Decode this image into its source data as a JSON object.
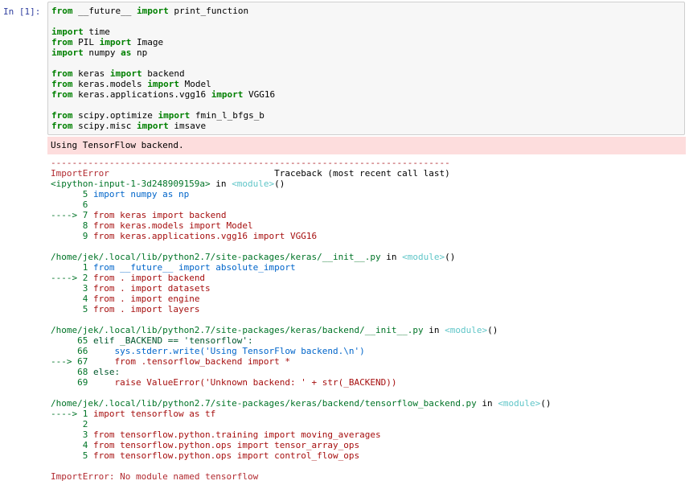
{
  "prompt": "In [1]:",
  "code_lines": [
    [
      {
        "t": "from",
        "c": "kw"
      },
      {
        "t": " __future__ ",
        "c": ""
      },
      {
        "t": "import",
        "c": "kw"
      },
      {
        "t": " print_function",
        "c": ""
      }
    ],
    [],
    [
      {
        "t": "import",
        "c": "kw"
      },
      {
        "t": " time",
        "c": ""
      }
    ],
    [
      {
        "t": "from",
        "c": "kw"
      },
      {
        "t": " PIL ",
        "c": ""
      },
      {
        "t": "import",
        "c": "kw"
      },
      {
        "t": " Image",
        "c": ""
      }
    ],
    [
      {
        "t": "import",
        "c": "kw"
      },
      {
        "t": " numpy ",
        "c": ""
      },
      {
        "t": "as",
        "c": "kw"
      },
      {
        "t": " np",
        "c": ""
      }
    ],
    [],
    [
      {
        "t": "from",
        "c": "kw"
      },
      {
        "t": " keras ",
        "c": ""
      },
      {
        "t": "import",
        "c": "kw"
      },
      {
        "t": " backend",
        "c": ""
      }
    ],
    [
      {
        "t": "from",
        "c": "kw"
      },
      {
        "t": " keras.models ",
        "c": ""
      },
      {
        "t": "import",
        "c": "kw"
      },
      {
        "t": " Model",
        "c": ""
      }
    ],
    [
      {
        "t": "from",
        "c": "kw"
      },
      {
        "t": " keras.applications.vgg16 ",
        "c": ""
      },
      {
        "t": "import",
        "c": "kw"
      },
      {
        "t": " VGG16",
        "c": ""
      }
    ],
    [],
    [
      {
        "t": "from",
        "c": "kw"
      },
      {
        "t": " scipy.optimize ",
        "c": ""
      },
      {
        "t": "import",
        "c": "kw"
      },
      {
        "t": " fmin_l_bfgs_b",
        "c": ""
      }
    ],
    [
      {
        "t": "from",
        "c": "kw"
      },
      {
        "t": " scipy.misc ",
        "c": ""
      },
      {
        "t": "import",
        "c": "kw"
      },
      {
        "t": " imsave",
        "c": ""
      }
    ]
  ],
  "stderr_text": "Using TensorFlow backend.",
  "traceback_lines": [
    [
      {
        "t": "---------------------------------------------------------------------------",
        "c": "red"
      }
    ],
    [
      {
        "t": "ImportError",
        "c": "red"
      },
      {
        "t": "                               Traceback (most recent call last)",
        "c": ""
      }
    ],
    [
      {
        "t": "<ipython-input-1-3d248909159a>",
        "c": "green"
      },
      {
        "t": " in ",
        "c": ""
      },
      {
        "t": "<module>",
        "c": "teal"
      },
      {
        "t": "()",
        "c": ""
      }
    ],
    [
      {
        "t": "      5 ",
        "c": "green"
      },
      {
        "t": "import numpy as np",
        "c": "blue"
      }
    ],
    [
      {
        "t": "      6 ",
        "c": "green"
      }
    ],
    [
      {
        "t": "----> 7 ",
        "c": "green"
      },
      {
        "t": "from keras import backend",
        "c": "darkred"
      }
    ],
    [
      {
        "t": "      8 ",
        "c": "green"
      },
      {
        "t": "from keras.models import Model",
        "c": "darkred"
      }
    ],
    [
      {
        "t": "      9 ",
        "c": "green"
      },
      {
        "t": "from keras.applications.vgg16 import VGG16",
        "c": "darkred"
      }
    ],
    [],
    [
      {
        "t": "/home/jek/.local/lib/python2.7/site-packages/keras/__init__.py",
        "c": "green"
      },
      {
        "t": " in ",
        "c": ""
      },
      {
        "t": "<module>",
        "c": "teal"
      },
      {
        "t": "()",
        "c": ""
      }
    ],
    [
      {
        "t": "      1 ",
        "c": "green"
      },
      {
        "t": "from __future__ import absolute_import",
        "c": "blue"
      }
    ],
    [
      {
        "t": "----> 2 ",
        "c": "green"
      },
      {
        "t": "from . import backend",
        "c": "darkred"
      }
    ],
    [
      {
        "t": "      3 ",
        "c": "green"
      },
      {
        "t": "from . import datasets",
        "c": "darkred"
      }
    ],
    [
      {
        "t": "      4 ",
        "c": "green"
      },
      {
        "t": "from . import engine",
        "c": "darkred"
      }
    ],
    [
      {
        "t": "      5 ",
        "c": "green"
      },
      {
        "t": "from . import layers",
        "c": "darkred"
      }
    ],
    [],
    [
      {
        "t": "/home/jek/.local/lib/python2.7/site-packages/keras/backend/__init__.py",
        "c": "green"
      },
      {
        "t": " in ",
        "c": ""
      },
      {
        "t": "<module>",
        "c": "teal"
      },
      {
        "t": "()",
        "c": ""
      }
    ],
    [
      {
        "t": "     65 ",
        "c": "green"
      },
      {
        "t": "elif _BACKEND == 'tensorflow':",
        "c": "darkgreen"
      }
    ],
    [
      {
        "t": "     66 ",
        "c": "green"
      },
      {
        "t": "    sys.stderr.write('Using TensorFlow backend.\\n')",
        "c": "blue"
      }
    ],
    [
      {
        "t": "---> 67 ",
        "c": "green"
      },
      {
        "t": "    from .tensorflow_backend import *",
        "c": "darkred"
      }
    ],
    [
      {
        "t": "     68 ",
        "c": "green"
      },
      {
        "t": "else:",
        "c": "darkgreen"
      }
    ],
    [
      {
        "t": "     69 ",
        "c": "green"
      },
      {
        "t": "    raise ValueError('Unknown backend: ' + str(_BACKEND))",
        "c": "darkred"
      }
    ],
    [],
    [
      {
        "t": "/home/jek/.local/lib/python2.7/site-packages/keras/backend/tensorflow_backend.py",
        "c": "green"
      },
      {
        "t": " in ",
        "c": ""
      },
      {
        "t": "<module>",
        "c": "teal"
      },
      {
        "t": "()",
        "c": ""
      }
    ],
    [
      {
        "t": "----> 1 ",
        "c": "green"
      },
      {
        "t": "import tensorflow as tf",
        "c": "darkred"
      }
    ],
    [
      {
        "t": "      2 ",
        "c": "green"
      }
    ],
    [
      {
        "t": "      3 ",
        "c": "green"
      },
      {
        "t": "from tensorflow.python.training import moving_averages",
        "c": "darkred"
      }
    ],
    [
      {
        "t": "      4 ",
        "c": "green"
      },
      {
        "t": "from tensorflow.python.ops import tensor_array_ops",
        "c": "darkred"
      }
    ],
    [
      {
        "t": "      5 ",
        "c": "green"
      },
      {
        "t": "from tensorflow.python.ops import control_flow_ops",
        "c": "darkred"
      }
    ],
    [],
    [
      {
        "t": "ImportError",
        "c": "red"
      },
      {
        "t": ": No module named tensorflow",
        "c": "red"
      }
    ]
  ],
  "colors": {
    "prompt": "#303f9f",
    "keyword": "#008000",
    "stderr_bg": "#fddddd",
    "error_red": "#b22b31"
  }
}
